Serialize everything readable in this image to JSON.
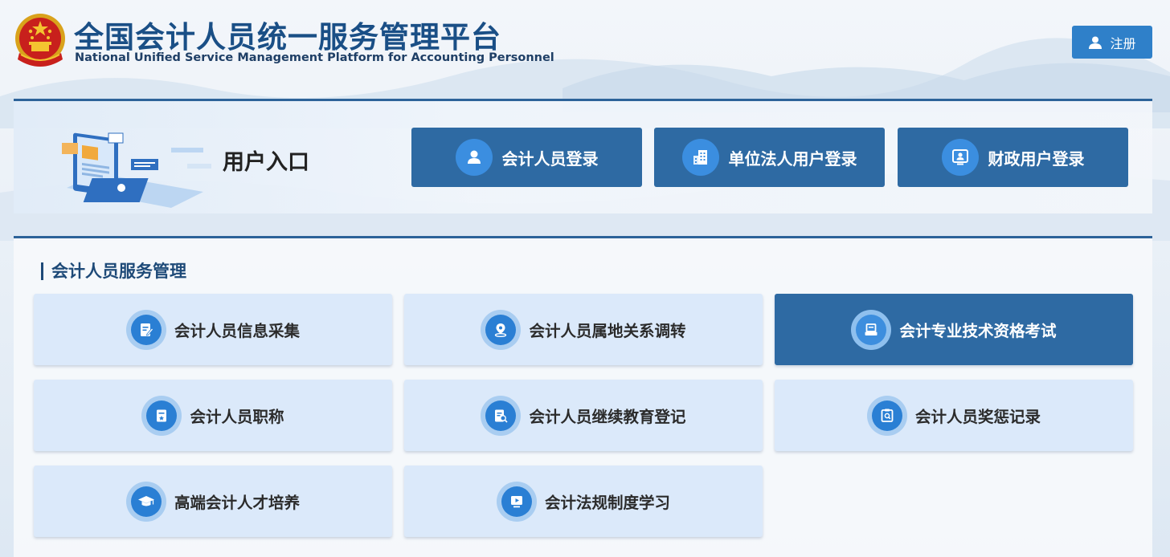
{
  "header": {
    "title_cn": "全国会计人员统一服务管理平台",
    "title_en": "National Unified Service Management Platform for Accounting Personnel",
    "register_label": "注册",
    "emblem_icon": "national-emblem-icon"
  },
  "login": {
    "section_label": "用户入口",
    "buttons": [
      {
        "label": "会计人员登录",
        "icon": "person-icon"
      },
      {
        "label": "单位法人用户登录",
        "icon": "building-icon"
      },
      {
        "label": "财政用户登录",
        "icon": "monitor-user-icon"
      }
    ]
  },
  "services": {
    "section_title": "会计人员服务管理",
    "items": [
      {
        "label": "会计人员信息采集",
        "icon": "form-edit-icon",
        "active": false
      },
      {
        "label": "会计人员属地关系调转",
        "icon": "location-transfer-icon",
        "active": false
      },
      {
        "label": "会计专业技术资格考试",
        "icon": "exam-icon",
        "active": true
      },
      {
        "label": "会计人员职称",
        "icon": "title-certificate-icon",
        "active": false
      },
      {
        "label": "会计人员继续教育登记",
        "icon": "education-search-icon",
        "active": false
      },
      {
        "label": "会计人员奖惩记录",
        "icon": "record-search-icon",
        "active": false
      },
      {
        "label": "高端会计人才培养",
        "icon": "graduation-cap-icon",
        "active": false
      },
      {
        "label": "会计法规制度学习",
        "icon": "video-play-icon",
        "active": false
      }
    ]
  },
  "colors": {
    "brand_dark": "#2e6aa3",
    "brand_title": "#1a4f86",
    "register_bg": "#2f80c9",
    "card_bg": "#dbe9fa"
  }
}
